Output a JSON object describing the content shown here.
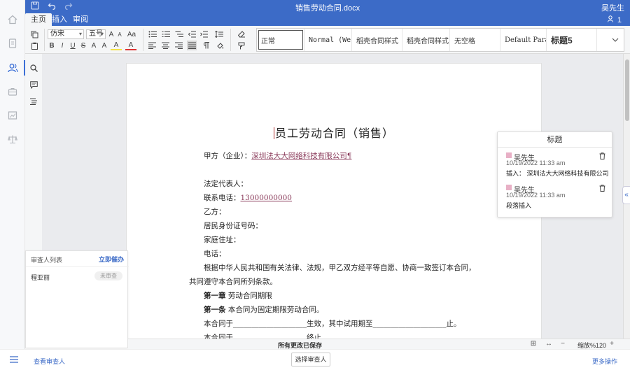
{
  "titlebar": {
    "title": "销售劳动合同.docx",
    "user": "吴先生"
  },
  "tabs": [
    "主页",
    "插入",
    "审阅"
  ],
  "collab": {
    "count": "1"
  },
  "ribbon": {
    "font_family": "仿宋",
    "font_size": "五号",
    "font_size_up": "A",
    "font_size_down": "A",
    "change_case": "Aa",
    "bold": "B",
    "italic": "I",
    "underline": "U",
    "strike": "S",
    "superscript": "A",
    "subscript": "A",
    "highlight": "A",
    "font_color": "A"
  },
  "styles": [
    "正常",
    "Normal (Web)",
    "稻壳合同样式",
    "稻壳合同样式：",
    "无空格",
    "Default Paragraph",
    "标题5"
  ],
  "document": {
    "title": "员工劳动合同（销售）",
    "lines": [
      {
        "prefix": "甲方（企业）：",
        "ins": "深圳法大大网络科技有限公司¶",
        "rest": ""
      },
      {
        "prefix": "",
        "ins": "",
        "rest": ""
      },
      {
        "prefix": "法定代表人：",
        "ins": "",
        "rest": ""
      },
      {
        "prefix": "联系电话：",
        "ins": "13000000000",
        "rest": ""
      },
      {
        "prefix": "乙方：",
        "ins": "",
        "rest": ""
      },
      {
        "prefix": "居民身份证号码：",
        "ins": "",
        "rest": ""
      },
      {
        "prefix": "家庭住址：",
        "ins": "",
        "rest": ""
      },
      {
        "prefix": "电话：",
        "ins": "",
        "rest": ""
      },
      {
        "prefix": "根据中华人民共和国有关法律、法规，甲乙双方经平等自愿、协商一致签订本合同，",
        "ins": "",
        "rest": ""
      },
      {
        "prefix": "共同遵守本合同所列条款。",
        "ins": "",
        "rest": ""
      },
      {
        "prefix": "第一章",
        "ins": "",
        "rest": "  劳动合同期限"
      },
      {
        "prefix": "第一条",
        "ins": "",
        "rest": "  本合同为固定期限劳动合同。"
      },
      {
        "prefix": "本合同于____________________生效，其中试用期至____________________止。",
        "ins": "",
        "rest": ""
      },
      {
        "prefix": "本合同于____________________终止。",
        "ins": "",
        "rest": ""
      }
    ]
  },
  "comments": {
    "header": "标题",
    "items": [
      {
        "author": "吴先生",
        "time": "10/19/2022 11:33 am",
        "body": "插入：  深圳法大大网络科技有限公司"
      },
      {
        "author": "吴先生",
        "time": "10/19/2022 11:33 am",
        "body": "段落插入"
      }
    ]
  },
  "reviewer": {
    "title": "审查人列表",
    "remind": "立即催办",
    "name": "程亚丽",
    "status": "未审查"
  },
  "statusbar": {
    "saved": "所有更改已保存",
    "zoom": "缩放%120"
  },
  "bottombar": {
    "view": "查看审查人",
    "select": "选择审查人",
    "more": "更多操作"
  },
  "colors": {
    "primary": "#3c6bc7",
    "insert": "#8a3a5a",
    "comment_mark": "#e8b0c6"
  }
}
